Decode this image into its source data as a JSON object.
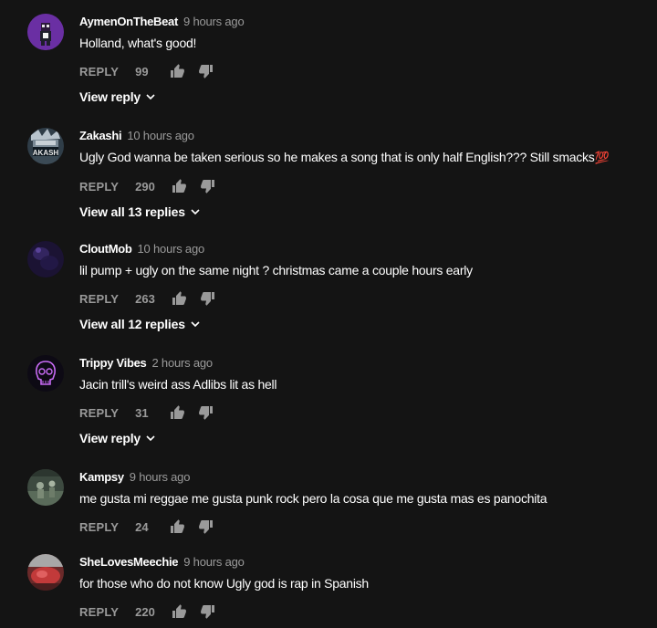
{
  "comments": [
    {
      "author": "AymenOnTheBeat",
      "time": "9 hours ago",
      "text": "Holland, what's good!",
      "emoji": "",
      "reply_label": "REPLY",
      "likes": "99",
      "replies_label": "View reply",
      "avatar_icon": "purple-character-avatar"
    },
    {
      "author": "Zakashi",
      "time": "10 hours ago",
      "text": "Ugly God wanna be taken serious so he makes a song that is only half English??? Still smacks",
      "emoji": "💯",
      "reply_label": "REPLY",
      "likes": "290",
      "replies_label": "View all 13 replies",
      "avatar_icon": "kakashi-avatar"
    },
    {
      "author": "CloutMob",
      "time": "10 hours ago",
      "text": "lil pump + ugly on the same night ? christmas came a couple hours early",
      "emoji": "",
      "reply_label": "REPLY",
      "likes": "263",
      "replies_label": "View all 12 replies",
      "avatar_icon": "dark-purple-avatar"
    },
    {
      "author": "Trippy Vibes",
      "time": "2 hours ago",
      "text": "Jacin trill's weird ass Adlibs lit as hell",
      "emoji": "",
      "reply_label": "REPLY",
      "likes": "31",
      "replies_label": "View reply",
      "avatar_icon": "neon-skull-avatar"
    },
    {
      "author": "Kampsy",
      "time": "9 hours ago",
      "text": "me gusta mi reggae me gusta punk rock pero la cosa que me gusta mas es panochita",
      "emoji": "",
      "reply_label": "REPLY",
      "likes": "24",
      "replies_label": "",
      "avatar_icon": "green-photo-avatar"
    },
    {
      "author": "SheLovesMeechie",
      "time": "9 hours ago",
      "text": "for those who do not know Ugly god is rap in Spanish",
      "emoji": "",
      "reply_label": "REPLY",
      "likes": "220",
      "replies_label": "",
      "avatar_icon": "red-photo-avatar"
    }
  ],
  "colors": {
    "background": "#141414",
    "secondary_text": "#9a9a9a",
    "primary_text": "#ffffff"
  }
}
